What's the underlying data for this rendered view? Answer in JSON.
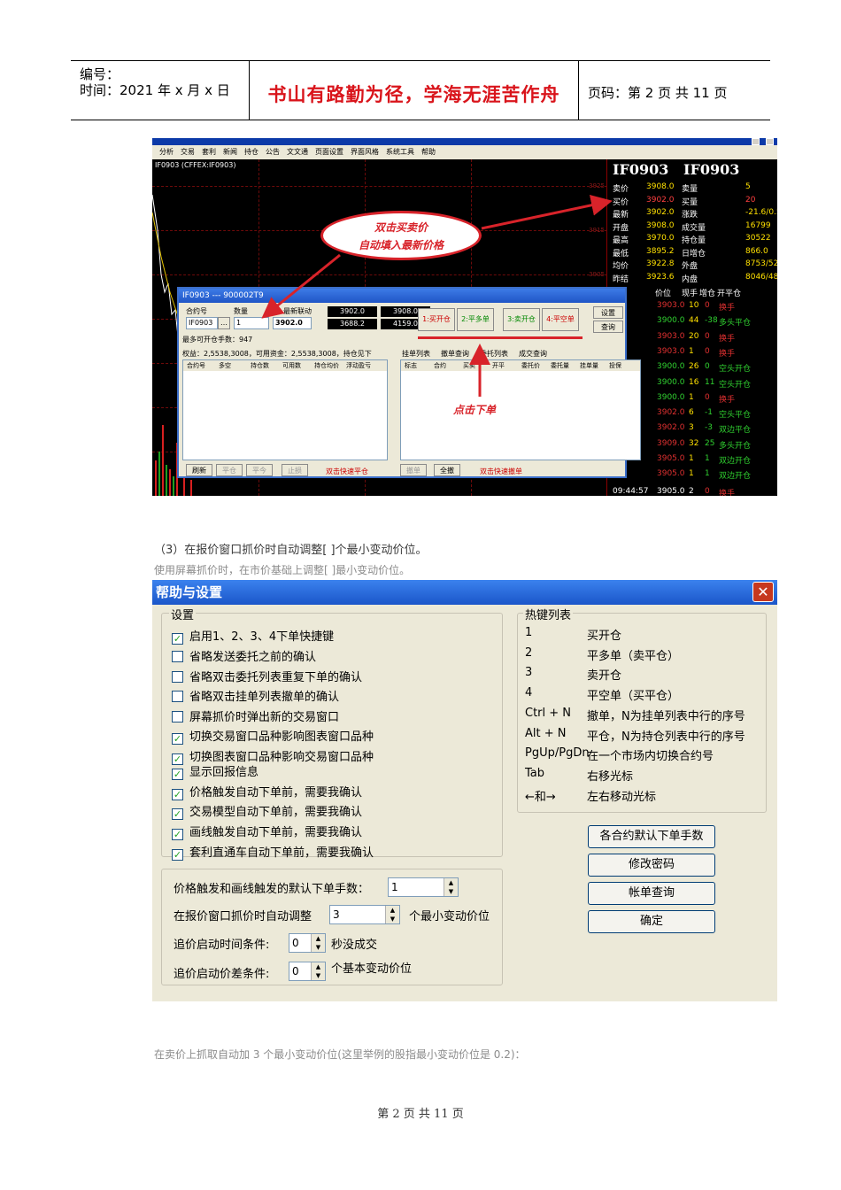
{
  "header": {
    "number_label": "编号：",
    "date_label": "时间：2021 年 x 月 x 日",
    "motto": "书山有路勤为径，学海无涯苦作舟",
    "page_label": "页码：第 2 页  共 11 页"
  },
  "terminal": {
    "menu": [
      "分析",
      "交易",
      "套利",
      "新闻",
      "持仓",
      "公告",
      "文文通",
      "页面设置",
      "界面风格",
      "系统工具",
      "帮助"
    ],
    "chart_title": "IF0903 (CFFEX:IF0903)",
    "scale_values": [
      "3925",
      "3915",
      "3905",
      "3895"
    ],
    "quote_titles": [
      "IF0903",
      "IF0903"
    ],
    "quote_rows": [
      [
        "卖价",
        "3908.0",
        "卖量",
        "5"
      ],
      [
        "买价",
        "3902.0",
        "买量",
        "20"
      ],
      [
        "最新",
        "3902.0",
        "涨跌",
        "-21.6/0.55%"
      ],
      [
        "开盘",
        "3908.0",
        "成交量",
        "16799"
      ],
      [
        "最高",
        "3970.0",
        "持仓量",
        "30522"
      ],
      [
        "最低",
        "3895.2",
        "日增仓",
        "866.0"
      ],
      [
        "均价",
        "3922.8",
        "外盘",
        "8753/52%"
      ],
      [
        "昨结",
        "3923.6",
        "内盘",
        "8046/48%"
      ]
    ],
    "tick_header": [
      "价位",
      "现手",
      "增仓",
      "开平仓"
    ],
    "ticks": [
      [
        "3903.0",
        "10",
        "0",
        "换手"
      ],
      [
        "3900.0",
        "44",
        "-38",
        "多头平仓"
      ],
      [
        "3903.0",
        "20",
        "0",
        "换手"
      ],
      [
        "3903.0",
        "1",
        "0",
        "换手"
      ],
      [
        "3900.0",
        "26",
        "0",
        "空头开仓"
      ],
      [
        "3900.0",
        "16",
        "11",
        "空头开仓"
      ],
      [
        "3900.0",
        "1",
        "0",
        "换手"
      ],
      [
        "3902.0",
        "6",
        "-1",
        "空头平仓"
      ],
      [
        "3902.0",
        "3",
        "-3",
        "双边平仓"
      ],
      [
        "3909.0",
        "32",
        "25",
        "多头开仓"
      ],
      [
        "3905.0",
        "1",
        "1",
        "双边开仓"
      ],
      [
        "3905.0",
        "1",
        "1",
        "双边开仓"
      ],
      [
        "3905.0",
        "2",
        "0",
        "换手"
      ]
    ],
    "last_time": "09:44:57",
    "order": {
      "title": "IF0903 --- 900002T9",
      "contract_label": "合约号",
      "qty_label": "数量",
      "price_label": "最新联动",
      "contract_value": "IF0903",
      "qty_value": "1",
      "price_value": "3902.0",
      "bid_prices": [
        "3902.0",
        "3688.2"
      ],
      "ask_prices": [
        "3908.0",
        "4159.0"
      ],
      "buttons": [
        "1:买开仓",
        "2:平多单",
        "3:卖开仓",
        "4:平空单"
      ],
      "side_buttons": [
        "设置",
        "查询"
      ],
      "max_label": "最多可开仓手数：947",
      "equity_label": "权益：2,5538,3008，可用资金：2,5538,3008，持仓见下",
      "pos_cols": [
        "合约号",
        "多空",
        "持仓数",
        "可用数",
        "持仓均价",
        "浮动盈亏"
      ],
      "order_tabs": [
        "挂单列表",
        "撤单查询",
        "委托列表",
        "成交查询"
      ],
      "order_cols": [
        "标志",
        "合约",
        "买卖",
        "开平",
        "委托价",
        "委托量",
        "挂单量",
        "投保"
      ],
      "bottom_left": [
        "刷新",
        "平仓",
        "平今",
        "止损"
      ],
      "quick_close": "双击快速平仓",
      "bottom_right": [
        "撤单",
        "全撤"
      ],
      "quick_cancel": "双击快速撤单"
    },
    "bubble_lines": [
      "双击买卖价",
      "自动填入最新价格"
    ],
    "click_label": "点击下单"
  },
  "para1": "（3）在报价窗口抓价时自动调整[ ]个最小变动价位。",
  "para2": "使用屏幕抓价时，在市价基础上调整[ ]最小变动价位。",
  "dialog": {
    "title": "帮助与设置",
    "settings_legend": "设置",
    "settings": [
      {
        "label": "启用1、2、3、4下单快捷键",
        "checked": true
      },
      {
        "label": "省略发送委托之前的确认",
        "checked": false
      },
      {
        "label": "省略双击委托列表重复下单的确认",
        "checked": false
      },
      {
        "label": "省略双击挂单列表撤单的确认",
        "checked": false
      },
      {
        "label": "屏幕抓价时弹出新的交易窗口",
        "checked": false
      },
      {
        "label": "切换交易窗口品种影响图表窗口品种",
        "checked": true
      },
      {
        "label": "切换图表窗口品种影响交易窗口品种",
        "checked": true
      },
      {
        "label": "显示回报信息",
        "checked": true
      },
      {
        "label": "价格触发自动下单前，需要我确认",
        "checked": true
      },
      {
        "label": "交易模型自动下单前，需要我确认",
        "checked": true
      },
      {
        "label": "画线触发自动下单前，需要我确认",
        "checked": true
      },
      {
        "label": "套利直通车自动下单前，需要我确认",
        "checked": true
      }
    ],
    "hotkeys_legend": "热键列表",
    "hotkeys": [
      [
        "1",
        "买开仓"
      ],
      [
        "2",
        "平多单（卖平仓）"
      ],
      [
        "3",
        "卖开仓"
      ],
      [
        "4",
        "平空单（买平仓）"
      ],
      [
        "Ctrl + N",
        "撤单，N为挂单列表中行的序号"
      ],
      [
        "Alt + N",
        "平仓，N为持仓列表中行的序号"
      ],
      [
        "PgUp/PgDn",
        "在一个市场内切换合约号"
      ],
      [
        "Tab",
        "右移光标"
      ],
      [
        "←和→",
        "左右移动光标"
      ]
    ],
    "buttons": [
      "各合约默认下单手数",
      "修改密码",
      "帐单查询",
      "确定"
    ],
    "fields": {
      "default_qty_label": "价格触发和画线触发的默认下单手数：",
      "default_qty_value": "1",
      "adjust_label": "在报价窗口抓价时自动调整",
      "adjust_value": "3",
      "adjust_unit": "个最小变动价位",
      "time_label": "追价启动时间条件:",
      "time_value": "0",
      "time_unit": "秒没成交",
      "diff_label": "追价启动价差条件:",
      "diff_value": "0",
      "diff_unit": "个基本变动价位"
    }
  },
  "para3": "在卖价上抓取自动加 3 个最小变动价位(这里举例的股指最小变动价位是 0.2)：",
  "footer": "第 2 页 共 11 页",
  "colors": {
    "motto": "#d9141b",
    "annotation": "#d8232a",
    "dialog_title": "#1b56c9"
  }
}
